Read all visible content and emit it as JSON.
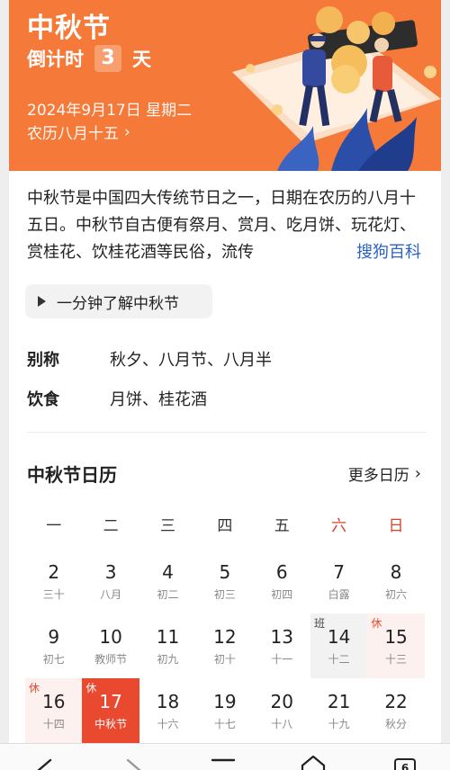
{
  "hero": {
    "title": "中秋节",
    "countdown_prefix": "倒计时",
    "countdown_days": "3",
    "countdown_suffix": "天",
    "date": "2024年9月17日 星期二",
    "lunar": "农历八月十五",
    "lunar_chevron": "›",
    "background_color": "#f57a3a"
  },
  "description": {
    "text": "中秋节是中国四大传统节日之一，日期在农历的八月十五日。中秋节自古便有祭月、赏月、吃月饼、玩花灯、赏桂花、饮桂花酒等民俗，流传",
    "source_link": "搜狗百科"
  },
  "video_button": {
    "label": "一分钟了解中秋节"
  },
  "info": [
    {
      "key": "别称",
      "value": "秋夕、八月节、八月半"
    },
    {
      "key": "饮食",
      "value": "月饼、桂花酒"
    }
  ],
  "calendar": {
    "title": "中秋节日历",
    "more_label": "更多日历",
    "more_chevron": "›",
    "weekdays": [
      "一",
      "二",
      "三",
      "四",
      "五",
      "六",
      "日"
    ],
    "weeks": [
      [
        {
          "day": "2",
          "lunar": "三十"
        },
        {
          "day": "3",
          "lunar": "八月"
        },
        {
          "day": "4",
          "lunar": "初二"
        },
        {
          "day": "5",
          "lunar": "初三"
        },
        {
          "day": "6",
          "lunar": "初四"
        },
        {
          "day": "7",
          "lunar": "白露"
        },
        {
          "day": "8",
          "lunar": "初六"
        }
      ],
      [
        {
          "day": "9",
          "lunar": "初七"
        },
        {
          "day": "10",
          "lunar": "教师节"
        },
        {
          "day": "11",
          "lunar": "初九"
        },
        {
          "day": "12",
          "lunar": "初十"
        },
        {
          "day": "13",
          "lunar": "十一"
        },
        {
          "day": "14",
          "lunar": "十二",
          "tag": "班"
        },
        {
          "day": "15",
          "lunar": "十三",
          "tag": "休"
        }
      ],
      [
        {
          "day": "16",
          "lunar": "十四",
          "tag": "休"
        },
        {
          "day": "17",
          "lunar": "中秋节",
          "tag": "休"
        },
        {
          "day": "18",
          "lunar": "十六"
        },
        {
          "day": "19",
          "lunar": "十七"
        },
        {
          "day": "20",
          "lunar": "十八"
        },
        {
          "day": "21",
          "lunar": "十九"
        },
        {
          "day": "22",
          "lunar": "秋分"
        }
      ]
    ],
    "accent_color": "#e8492f"
  },
  "navbar": {
    "back_icon": "back-arrow-icon",
    "forward_icon": "forward-arrow-icon",
    "menu_icon": "menu-icon",
    "home_icon": "home-icon",
    "tabs_count": "6"
  }
}
